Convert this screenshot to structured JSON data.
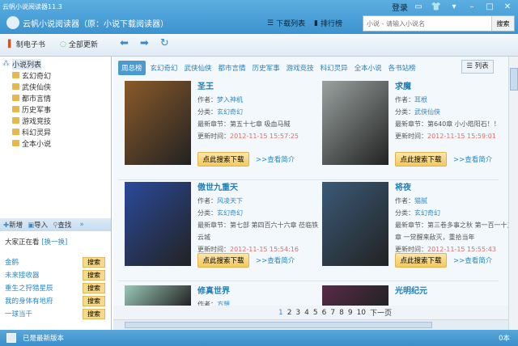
{
  "window": {
    "title": "云帆小说阅读器11.3",
    "login": "登录"
  },
  "header": {
    "app_name": "云帆小说阅读器（原：小说下载阅读器）",
    "download_list": "下载列表",
    "ranking": "排行榜",
    "search_placeholder": "小说 - 请输入小说名",
    "search_button": "搜索"
  },
  "toolbar": {
    "make_ebook": "制电子书",
    "update_all": "全部更新"
  },
  "sidebar": {
    "root": "小说列表",
    "items": [
      "玄幻奇幻",
      "武侠仙侠",
      "都市言情",
      "历史军事",
      "游戏竞技",
      "科幻灵异",
      "全本小说"
    ],
    "actions": {
      "add": "新增",
      "import": "导入",
      "find": "查找"
    },
    "watching": "大家正在看",
    "swap": "[换一换]",
    "hot": [
      {
        "name": "金鹤",
        "btn": "搜索"
      },
      {
        "name": "未来接收器",
        "btn": "搜索"
      },
      {
        "name": "重生之狩猎星辰",
        "btn": "搜索"
      },
      {
        "name": "我的身体有地府",
        "btn": "搜索"
      },
      {
        "name": "一球当千",
        "btn": "搜索"
      }
    ]
  },
  "tabs": [
    "周总榜",
    "玄幻奇幻",
    "武侠仙侠",
    "都市言情",
    "历史军事",
    "游戏竞技",
    "科幻灵异",
    "全本小说",
    "各书站榜"
  ],
  "view_button": "列表",
  "labels": {
    "author": "作者：",
    "category": "分类：",
    "latest": "最新章节：",
    "updated": "更新时间：",
    "download": "点此搜索下载",
    "intro": ">>查看简介"
  },
  "books": [
    {
      "title": "圣王",
      "author": "梦入神机",
      "category": "玄幻奇幻",
      "latest": "第五十七章 吸血马贼",
      "time": "2012-11-15 15:57:25",
      "color": "#8a5a2a"
    },
    {
      "title": "求魔",
      "author": "耳根",
      "category": "武侠仙侠",
      "latest": "第640章 小小皓阳石！！",
      "time": "2012-11-15 15:59:01",
      "color": "#9aa2a0"
    },
    {
      "title": "傲世九重天",
      "author": "风凌天下",
      "category": "玄幻奇幻",
      "latest": "第七部 第四百六十六章 莅临铁云城",
      "time": "2012-11-15 15:54:16",
      "color": "#2a4a9a"
    },
    {
      "title": "将夜",
      "author": "猫腻",
      "category": "玄幻奇幻",
      "latest": "第三卷多事之秋 第一百一十五章 一觉醒来敌灭，重拾当年",
      "time": "2012-11-15 15:55:43",
      "color": "#3a5a78"
    },
    {
      "title": "修真世界",
      "author": "方想",
      "color": "#9ac8b8"
    },
    {
      "title": "光明纪元",
      "color": "#5a2a4a"
    }
  ],
  "pager": {
    "pages": [
      "1",
      "2",
      "3",
      "4",
      "5",
      "6",
      "7",
      "8",
      "9",
      "10"
    ],
    "next": "下一页"
  },
  "status": {
    "text": "已是最新版本",
    "count": "0本"
  }
}
